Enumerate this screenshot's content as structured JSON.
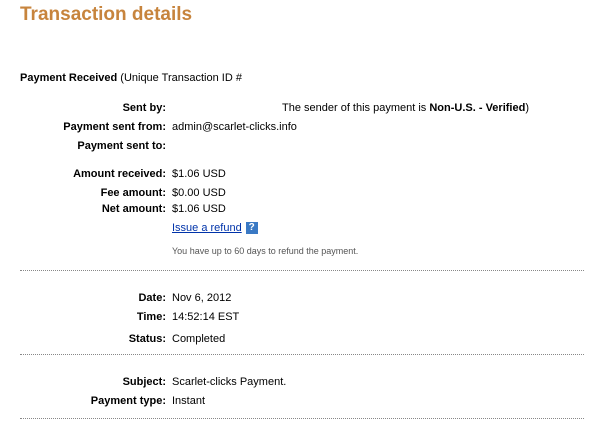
{
  "page": {
    "title": "Transaction details"
  },
  "payment_received": {
    "label": "Payment Received",
    "rest": " (Unique Transaction ID #"
  },
  "details": {
    "sent_by_label": "Sent by:",
    "sender_note_prefix": "The sender of this payment is ",
    "sender_note_strong": "Non-U.S. - Verified",
    "sender_note_suffix": ")",
    "sent_from_label": "Payment sent from:",
    "sent_from_value": "admin@scarlet-clicks.info",
    "sent_to_label": "Payment sent to:",
    "amount_received_label": "Amount received:",
    "amount_received_value": "$1.06 USD",
    "fee_label": "Fee amount:",
    "fee_value": "$0.00 USD",
    "net_label": "Net amount:",
    "net_value": "$1.06 USD"
  },
  "refund": {
    "link": "Issue a refund",
    "help_icon": "?",
    "note": "You have up to 60 days to refund the payment."
  },
  "timing": {
    "date_label": "Date:",
    "date_value": "Nov 6, 2012",
    "time_label": "Time:",
    "time_value": "14:52:14 EST",
    "status_label": "Status:",
    "status_value": "Completed"
  },
  "subject_block": {
    "subject_label": "Subject:",
    "subject_value": "Scarlet-clicks Payment.",
    "type_label": "Payment type:",
    "type_value": "Instant"
  },
  "icons": {
    "help": "help-icon"
  }
}
